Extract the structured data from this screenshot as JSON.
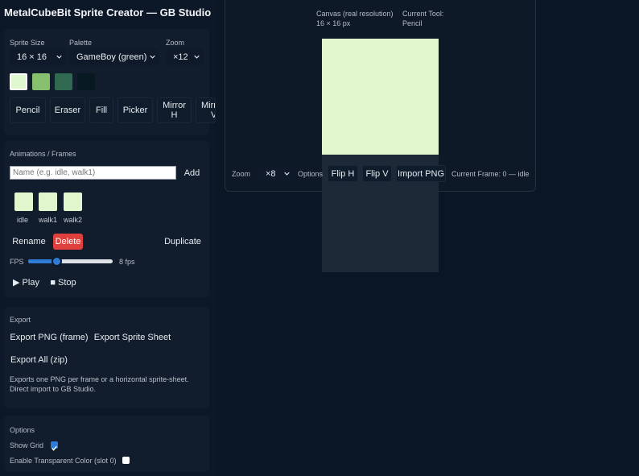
{
  "app": {
    "title": "MetalCubeBit Sprite Creator — GB Studio"
  },
  "settings": {
    "sprite_size_label": "Sprite Size",
    "sprite_size_value": "16 × 16",
    "palette_label": "Palette",
    "palette_value": "GameBoy (green)",
    "zoom_label": "Zoom",
    "zoom_value": "×12"
  },
  "palette_colors": [
    "#e0f8cf",
    "#86c06c",
    "#306850",
    "#071821"
  ],
  "tools": {
    "pencil": "Pencil",
    "eraser": "Eraser",
    "fill": "Fill",
    "picker": "Picker",
    "mirror_h_1": "Mirror",
    "mirror_h_2": "H",
    "mirror_v_1": "Mirror",
    "mirror_v_2": "V"
  },
  "animations": {
    "heading": "Animations / Frames",
    "name_placeholder": "Name (e.g. idle, walk1)",
    "add": "Add",
    "frames": [
      "idle",
      "walk1",
      "walk2"
    ],
    "rename": "Rename",
    "delete": "Delete",
    "duplicate": "Duplicate",
    "fps_label": "FPS",
    "fps_value": "8 fps",
    "fps_fraction": 0.33,
    "play": "▶ Play",
    "stop": "■ Stop"
  },
  "export": {
    "heading": "Export",
    "png_frame": "Export PNG (frame)",
    "sprite_sheet": "Export Sprite Sheet",
    "all_zip": "Export All (zip)",
    "help_line1": "Exports one PNG per frame or a horizontal sprite-sheet.",
    "help_line2": "Direct import to GB Studio."
  },
  "options": {
    "heading": "Options",
    "show_grid": "Show Grid",
    "show_grid_checked": true,
    "transparent": "Enable Transparent Color (slot 0)",
    "transparent_checked": false
  },
  "canvas_info": {
    "real_res_label": "Canvas (real resolution)",
    "real_res_value": "16 × 16 px",
    "tool_label": "Current Tool:",
    "tool_value": "Pencil"
  },
  "canvas_toolbar": {
    "zoom_label": "Zoom",
    "zoom_value": "×8",
    "options_label": "Options",
    "flip_h": "Flip H",
    "flip_v": "Flip V",
    "import_png": "Import PNG",
    "current_frame": "Current Frame: 0 — idle"
  },
  "colors": {
    "accent": "#2e7cd6",
    "danger": "#e0403d",
    "canvas": "#e0f6cd"
  }
}
